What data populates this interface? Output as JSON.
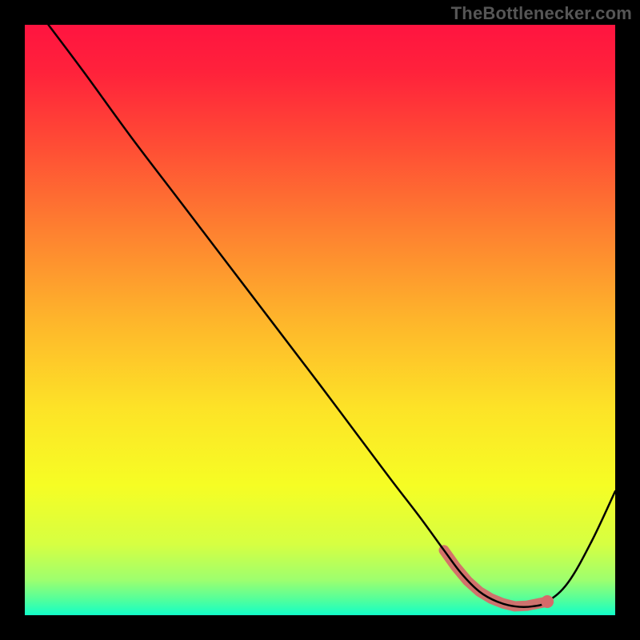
{
  "attribution": "TheBottlenecker.com",
  "chart_data": {
    "type": "line",
    "title": "",
    "xlabel": "",
    "ylabel": "",
    "xlim": [
      0,
      100
    ],
    "ylim": [
      0,
      100
    ],
    "grid": false,
    "gradient_stops": [
      {
        "offset": 0.0,
        "color": "#ff1440"
      },
      {
        "offset": 0.08,
        "color": "#ff223b"
      },
      {
        "offset": 0.2,
        "color": "#ff4b35"
      },
      {
        "offset": 0.35,
        "color": "#fe8130"
      },
      {
        "offset": 0.5,
        "color": "#feb52b"
      },
      {
        "offset": 0.65,
        "color": "#fde327"
      },
      {
        "offset": 0.78,
        "color": "#f6fd24"
      },
      {
        "offset": 0.88,
        "color": "#d6ff42"
      },
      {
        "offset": 0.94,
        "color": "#9eff6e"
      },
      {
        "offset": 0.975,
        "color": "#4fff9e"
      },
      {
        "offset": 1.0,
        "color": "#12ffc8"
      }
    ],
    "series": [
      {
        "name": "bottleneck-curve",
        "x": [
          4,
          10,
          18,
          26,
          34,
          42,
          50,
          56,
          62,
          67,
          71,
          74,
          77,
          80,
          83,
          86,
          88.5,
          92,
          96,
          100
        ],
        "y": [
          100,
          92,
          81,
          70.5,
          60,
          49.5,
          39,
          31,
          23,
          16.5,
          11,
          7,
          4,
          2.3,
          1.5,
          1.5,
          2.3,
          5.5,
          12.5,
          21
        ]
      }
    ],
    "highlight": {
      "name": "optimal-range",
      "x": [
        71,
        73,
        75,
        77,
        79,
        81,
        83,
        85,
        87,
        88.5
      ],
      "y": [
        11,
        8.2,
        5.8,
        4,
        2.8,
        2,
        1.5,
        1.6,
        2,
        2.3
      ],
      "marker_color": "#d56a6a",
      "marker_radius_px": 6,
      "end_marker_radius_px": 8,
      "stroke_color": "#d56a6a",
      "stroke_width_px": 13
    }
  }
}
